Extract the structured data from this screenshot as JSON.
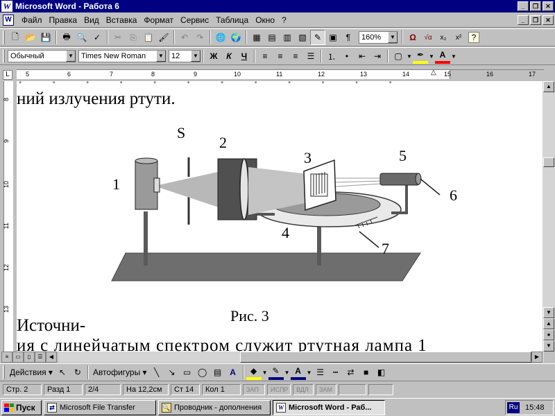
{
  "window": {
    "title": "Microsoft Word - Работа 6",
    "app_icon_letter": "W"
  },
  "menu": {
    "items": [
      "Файл",
      "Правка",
      "Вид",
      "Вставка",
      "Формат",
      "Сервис",
      "Таблица",
      "Окно",
      "?"
    ]
  },
  "standard_toolbar": {
    "zoom": "160%",
    "omega_symbol": "Ω",
    "sqrt_symbol": "√α",
    "subscript": "x₂",
    "superscript": "x²",
    "pilcrow": "¶",
    "help": "?"
  },
  "formatting_toolbar": {
    "style": "Обычный",
    "font": "Times New Roman",
    "size": "12",
    "bold": "Ж",
    "italic": "К",
    "underline": "Ч"
  },
  "ruler": {
    "numbers": [
      "5",
      "6",
      "7",
      "8",
      "9",
      "10",
      "11",
      "12",
      "13",
      "14",
      "15",
      "16",
      "17"
    ],
    "vertical_numbers": [
      "8",
      "9",
      "10",
      "11",
      "12",
      "13"
    ]
  },
  "document": {
    "line_top": "ний излучения ртути.",
    "caption": "Рис. 3",
    "line_source": "Источни-",
    "line_bottom": "ия с линейчатым спектром служит ртутная лампа 1"
  },
  "figure": {
    "label_1": "1",
    "label_S": "S",
    "label_2": "2",
    "label_3": "3",
    "label_4": "4",
    "label_5": "5",
    "label_6": "6",
    "label_7": "7"
  },
  "drawing_toolbar": {
    "actions": "Действия",
    "autoshapes": "Автофигуры"
  },
  "status": {
    "page": "Стр. 2",
    "section": "Разд 1",
    "pages": "2/4",
    "position": "На 12,2см",
    "line": "Ст 14",
    "column": "Кол 1",
    "rec": "ЗАП",
    "trk": "ИСПР",
    "ext": "ВДЛ",
    "ovr": "ЗАМ"
  },
  "taskbar": {
    "start": "Пуск",
    "tasks": [
      "Microsoft File Transfer",
      "Проводник - дополнения",
      "Microsoft Word - Раб..."
    ],
    "language": "Ru",
    "clock": "15:48"
  },
  "colors": {
    "titlebar": "#000080",
    "face": "#c0c0c0",
    "highlight_yellow": "#ffff00",
    "font_red": "#ff0000"
  }
}
